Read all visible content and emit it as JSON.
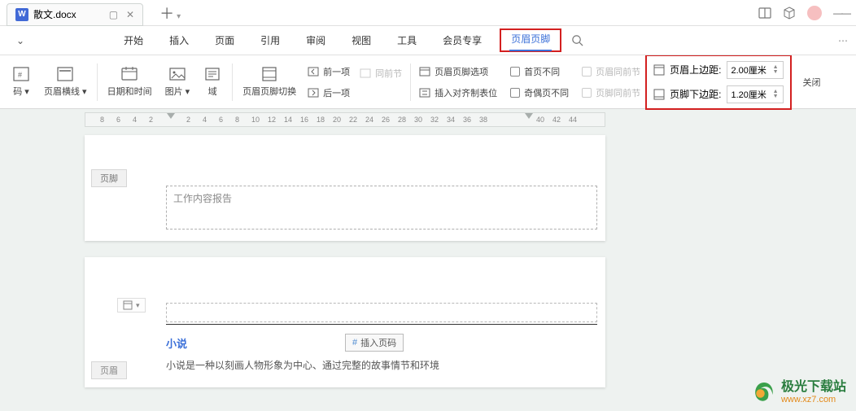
{
  "titlebar": {
    "doc_icon_letter": "W",
    "filename": "散文.docx",
    "plus": "＋"
  },
  "menu": {
    "items": [
      "开始",
      "插入",
      "页面",
      "引用",
      "审阅",
      "视图",
      "工具",
      "会员专享",
      "页眉页脚"
    ],
    "active_index": 8
  },
  "ribbon": {
    "number_label": "码 ▾",
    "line_label": "页眉横线 ▾",
    "datetime_label": "日期和时间",
    "picture_label": "图片 ▾",
    "field_label": "域",
    "switch_label": "页眉页脚切换",
    "prev_label": "前一项",
    "next_label": "后一项",
    "same_prev_label": "同前节",
    "options_label": "页眉页脚选项",
    "align_tab_label": "插入对齐制表位",
    "first_diff_label": "首页不同",
    "odd_even_label": "奇偶页不同",
    "header_same_label": "页眉同前节",
    "footer_same_label": "页脚同前节",
    "header_margin_label": "页眉上边距:",
    "footer_margin_label": "页脚下边距:",
    "header_margin_value": "2.00厘米",
    "footer_margin_value": "1.20厘米",
    "close_label": "关闭"
  },
  "ruler": {
    "ticks_left": [
      "8",
      "6",
      "4",
      "2"
    ],
    "ticks_right": [
      "2",
      "4",
      "6",
      "8",
      "10",
      "12",
      "14",
      "16",
      "18",
      "20",
      "22",
      "24",
      "26",
      "28",
      "30",
      "32",
      "34",
      "36",
      "38",
      "40",
      "42",
      "44"
    ]
  },
  "page1": {
    "tag": "页脚",
    "placeholder": "工作内容报告"
  },
  "page2": {
    "tag": "页眉",
    "title": "小说",
    "insert_btn": "插入页码",
    "body": "小说是一种以刻画人物形象为中心、通过完整的故事情节和环境"
  },
  "watermark": {
    "cn": "极光下载站",
    "en": "www.xz7.com"
  }
}
